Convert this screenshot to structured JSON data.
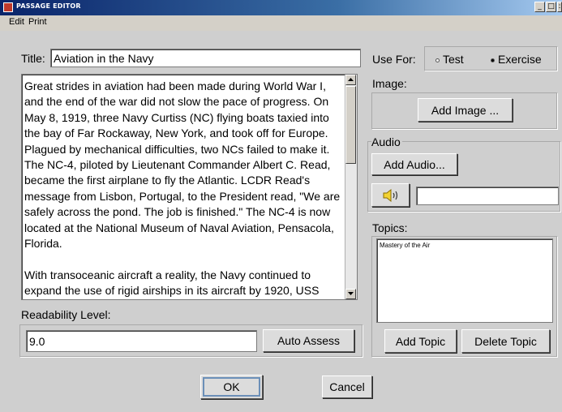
{
  "window": {
    "title": "PASSAGE EDITOR"
  },
  "menu": [
    {
      "label": "Edit"
    },
    {
      "label": "Print"
    }
  ],
  "title_field": {
    "label": "Title:",
    "value": "Aviation in the Navy"
  },
  "passage": {
    "text": "Great strides in aviation had been made during World War I, and the end of the war did not slow the pace of progress. On May 8, 1919, three Navy Curtiss (NC) flying boats taxied into the bay of Far Rockaway, New York, and took off for Europe. Plagued by mechanical difficulties, two NCs failed to make it. The NC-4, piloted by Lieutenant Commander Albert C. Read, became the first airplane to fly the Atlantic. LCDR Read's message from Lisbon, Portugal, to the President read, \"We are safely across the pond. The job is finished.\" The NC-4 is now located at the National Museum of Naval Aviation, Pensacola, Florida.\n\nWith transoceanic aircraft a reality, the Navy continued to expand the use of rigid airships in its aircraft by 1920, USS"
  },
  "readability": {
    "label": "Readability Level:",
    "value": "9.0",
    "auto_assess_label": "Auto Assess"
  },
  "use_for": {
    "label": "Use For:",
    "options": [
      {
        "label": "Test",
        "selected": false
      },
      {
        "label": "Exercise",
        "selected": true
      }
    ]
  },
  "image": {
    "label": "Image:",
    "add_label": "Add Image ..."
  },
  "audio": {
    "label": "Audio",
    "add_label": "Add Audio...",
    "speaker_icon": "speaker-icon",
    "file_value": ""
  },
  "topics": {
    "label": "Topics:",
    "items": [
      "Mastery of the Air"
    ],
    "add_label": "Add Topic",
    "delete_label": "Delete Topic"
  },
  "dialog": {
    "ok_label": "OK",
    "cancel_label": "Cancel"
  },
  "colors": {
    "titlebar": "#0a246a",
    "window_bg": "#cfcfcf",
    "focus": "#6b8fb8"
  }
}
